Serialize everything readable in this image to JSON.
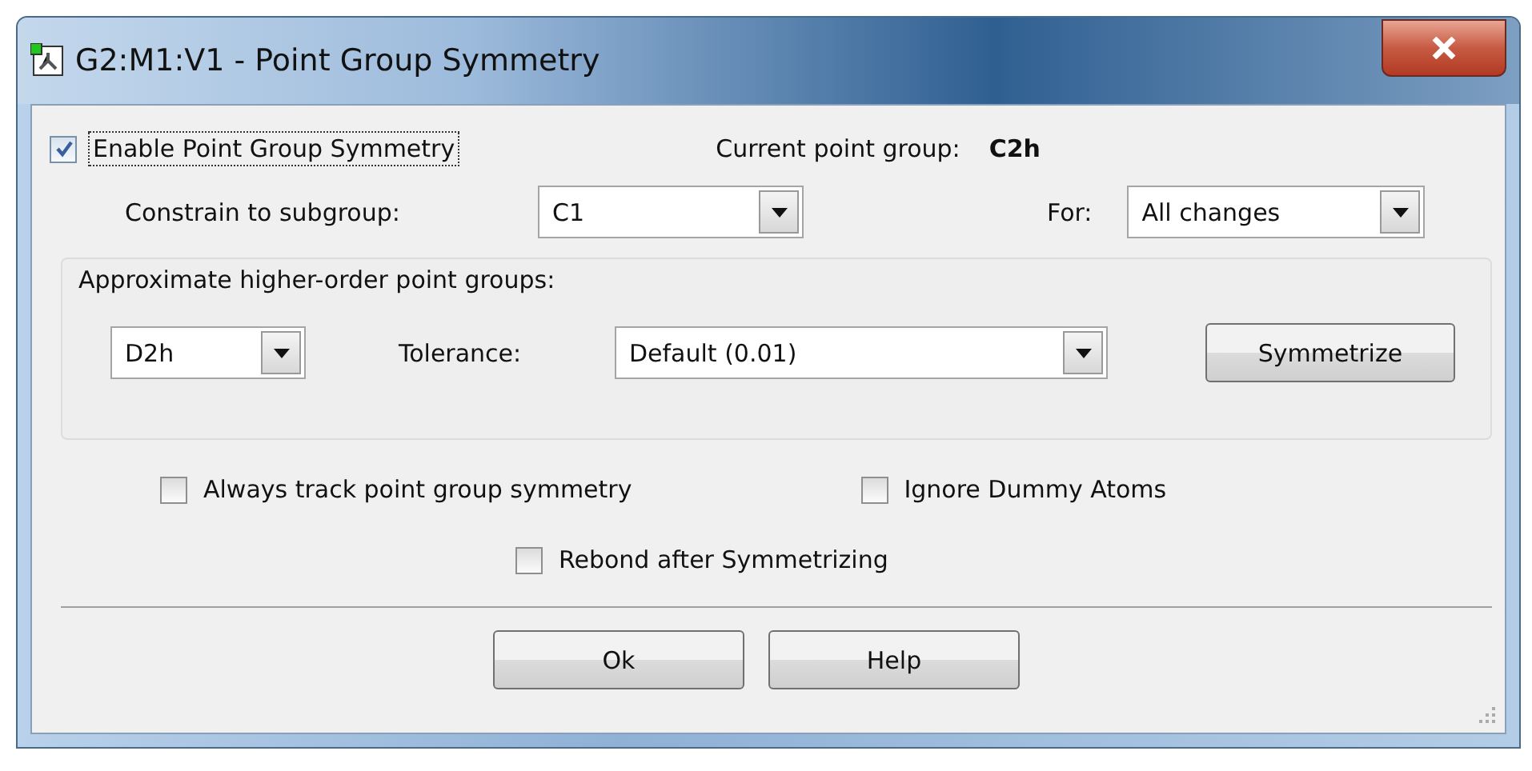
{
  "window": {
    "title": "G2:M1:V1 - Point Group Symmetry"
  },
  "enable": {
    "label": "Enable Point Group Symmetry",
    "checked": true,
    "focused": true
  },
  "current_point_group": {
    "label": "Current point group:",
    "value": "C2h"
  },
  "constrain": {
    "label": "Constrain to subgroup:",
    "value": "C1"
  },
  "for": {
    "label": "For:",
    "value": "All changes"
  },
  "approximate": {
    "title": "Approximate higher-order point groups:",
    "group": "D2h",
    "tolerance_label": "Tolerance:",
    "tolerance": "Default (0.01)",
    "button": "Symmetrize"
  },
  "options": [
    {
      "label": "Always track point group symmetry",
      "checked": false
    },
    {
      "label": "Ignore Dummy Atoms",
      "checked": false
    },
    {
      "label": "Rebond after Symmetrizing",
      "checked": false
    }
  ],
  "buttons": [
    "Ok",
    "Help"
  ]
}
